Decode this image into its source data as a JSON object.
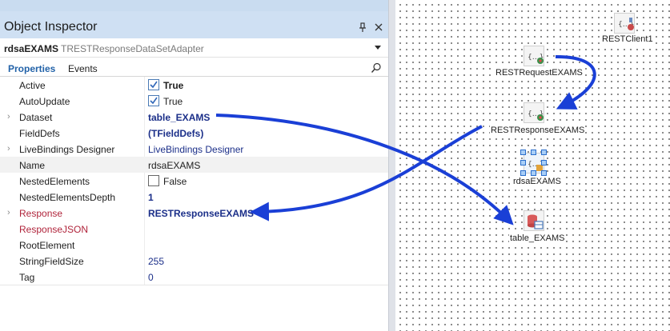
{
  "inspector": {
    "title": "Object Inspector",
    "pin_glyph": "ᵋ",
    "close_glyph": "×",
    "object_name": "rdsaEXAMS",
    "object_class": "TRESTResponseDataSetAdapter",
    "tabs": {
      "properties": "Properties",
      "events": "Events"
    },
    "rows": [
      {
        "name": "Active",
        "value": "True"
      },
      {
        "name": "AutoUpdate",
        "value": "True"
      },
      {
        "name": "Dataset",
        "value": "table_EXAMS",
        "expander": "›"
      },
      {
        "name": "FieldDefs",
        "value": "(TFieldDefs)"
      },
      {
        "name": "LiveBindings Designer",
        "value": "LiveBindings Designer",
        "expander": "›"
      },
      {
        "name": "Name",
        "value": "rdsaEXAMS"
      },
      {
        "name": "NestedElements",
        "value": "False"
      },
      {
        "name": "NestedElementsDepth",
        "value": "1"
      },
      {
        "name": "Response",
        "value": "RESTResponseEXAMS",
        "expander": "›"
      },
      {
        "name": "ResponseJSON",
        "value": ""
      },
      {
        "name": "RootElement",
        "value": ""
      },
      {
        "name": "StringFieldSize",
        "value": "255"
      },
      {
        "name": "Tag",
        "value": "0"
      }
    ]
  },
  "designer": {
    "components": {
      "rest_client": "RESTClient1",
      "rest_request": "RESTRequestEXAMS",
      "rest_response": "RESTResponseEXAMS",
      "adapter": "rdsaEXAMS",
      "table": "table_EXAMS"
    }
  },
  "colors": {
    "arrow": "#1a3fd6",
    "title_bar": "#cfe0f3",
    "value_text": "#1b2f89",
    "red_property": "#b0243b",
    "selection_handle": "#a9cff7"
  },
  "icons": {
    "pin": "pin-icon",
    "close": "close-icon",
    "search": "search-icon",
    "dropdown": "chevron-down-icon",
    "checkbox": "checkbox-icon",
    "rest_component": "rest-component-icon",
    "table_component": "table-component-icon"
  }
}
